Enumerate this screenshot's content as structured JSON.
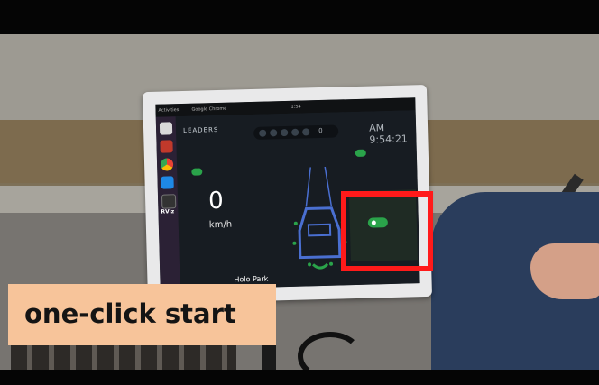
{
  "caption": {
    "text": "one-click start"
  },
  "screen": {
    "topbar": {
      "activities": "Activities",
      "app_menu": "Google Chrome",
      "clock": "1:54 ",
      "window_title": ""
    },
    "dock": {
      "rviz_label": "RViz"
    },
    "app": {
      "brand": "LEADERS",
      "time": "AM 9:54:21",
      "status_pill": "",
      "speed_value": "0",
      "speed_unit": "km/h",
      "location": "Holo Park",
      "right_pill": "",
      "hint_text": "",
      "start_button_label": "",
      "destination": "",
      "dot_count_value": "0"
    }
  },
  "colors": {
    "highlight": "#ff1a1a",
    "caption_bg": "#f7c49a",
    "accent_green": "#2aa34a"
  },
  "icons": [
    "chrome-icon",
    "vscode-icon",
    "terminal-icon",
    "files-icon",
    "car-icon"
  ]
}
